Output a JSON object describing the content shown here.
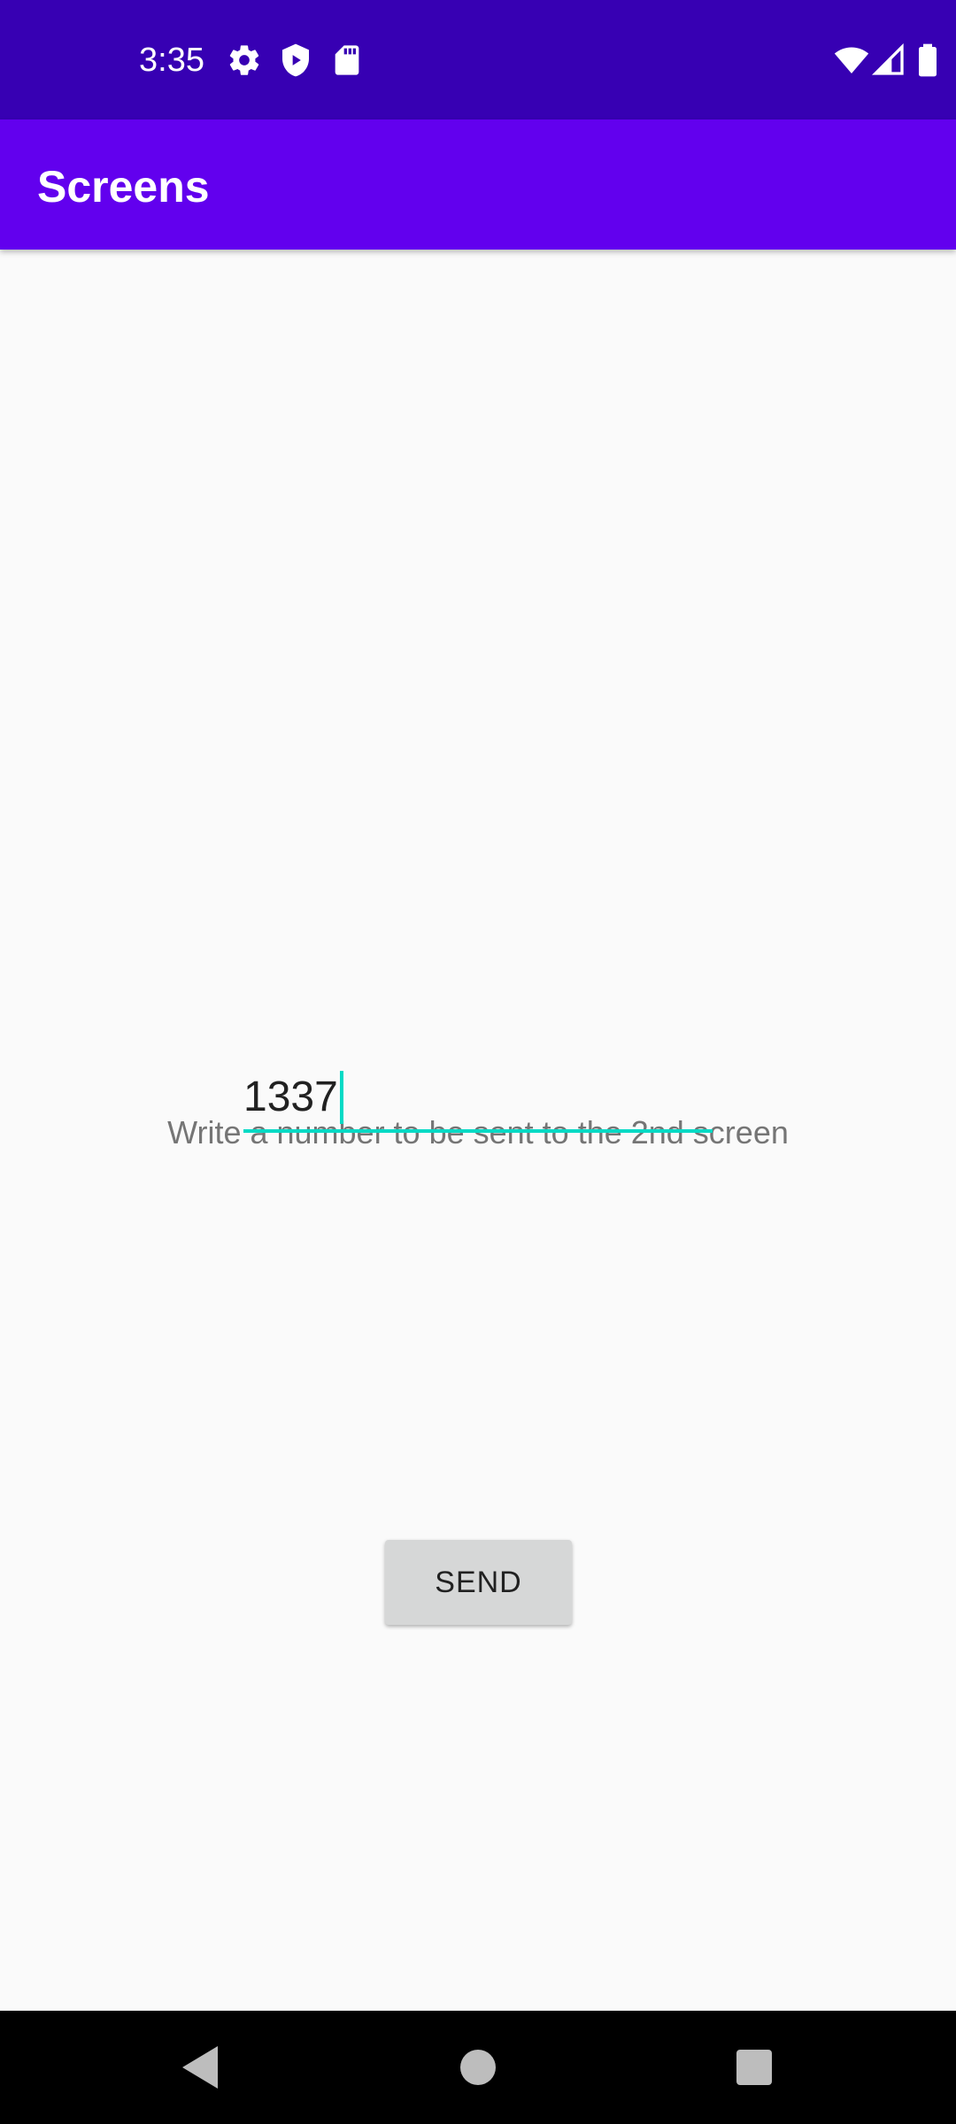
{
  "status_bar": {
    "time": "3:35",
    "left_icons": [
      "gear-icon",
      "shield-icon",
      "sd-card-icon"
    ],
    "right_icons": [
      "wifi-icon",
      "signal-icon",
      "battery-icon"
    ]
  },
  "app_bar": {
    "title": "Screens"
  },
  "main": {
    "prompt": "Write a number to be sent to the 2nd screen",
    "number_input": {
      "value": "1337"
    },
    "send_button_label": "SEND"
  },
  "nav_bar": {
    "buttons": [
      "back-icon",
      "home-icon",
      "recents-icon"
    ]
  },
  "colors": {
    "status_bar": "#3700b3",
    "app_bar": "#6200ee",
    "accent": "#03dac5",
    "background": "#fafafa",
    "button": "#d6d7d7"
  }
}
